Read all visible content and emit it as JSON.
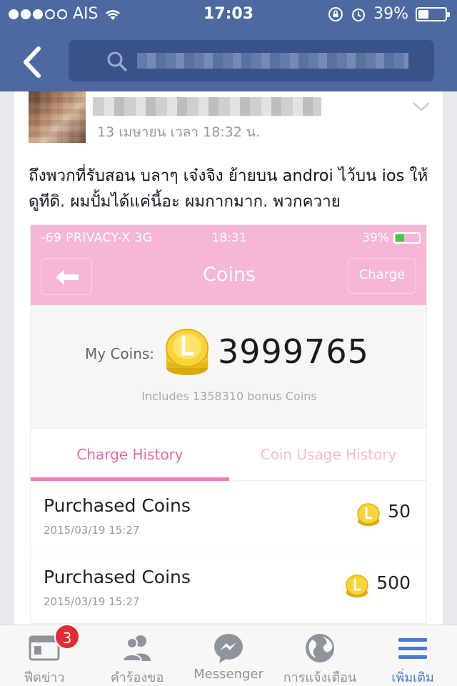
{
  "status_bar": {
    "carrier": "AIS",
    "time": "17:03",
    "battery": "39%",
    "battery_level": 0.39
  },
  "nav": {
    "search_placeholder": ""
  },
  "post": {
    "timestamp": "13 เมษายน เวลา 18:32 น.",
    "text": "ถึงพวกที่รับสอน บลาๆ  เจ๋งจิง ย้ายบน androi ไว้บน ios ให้ดูทีดิ. ผมปั้มได้แค่นี้อะ ผมกากมาก. พวกควาย"
  },
  "embedded": {
    "status": {
      "left": "-69 PRIVACY-X  3G",
      "time": "18:31",
      "battery": "39%"
    },
    "header": {
      "title": "Coins",
      "charge_label": "Charge"
    },
    "my_coins_label": "My Coins:",
    "my_coins_value": "3999765",
    "bonus_text": "Includes 1358310 bonus Coins",
    "tabs": [
      "Charge History",
      "Coin Usage History"
    ],
    "rows": [
      {
        "title": "Purchased Coins",
        "date": "2015/03/19 15:27",
        "amount": "50"
      },
      {
        "title": "Purchased Coins",
        "date": "2015/03/19 15:27",
        "amount": "500"
      }
    ],
    "colors": {
      "pink": "#f6b6d6",
      "accent": "#e36aa6"
    }
  },
  "tabbar": {
    "items": [
      {
        "label": "ฟีดข่าว",
        "icon": "news-feed-icon",
        "badge": "3"
      },
      {
        "label": "คำร้องขอ",
        "icon": "friend-requests-icon"
      },
      {
        "label": "Messenger",
        "icon": "messenger-icon"
      },
      {
        "label": "การแจ้งเตือน",
        "icon": "globe-icon"
      },
      {
        "label": "เพิ่มเติม",
        "icon": "menu-icon"
      }
    ],
    "active_color": "#4a77d4"
  },
  "colors": {
    "facebook_blue": "#4e69a2",
    "badge_red": "#e52b31"
  }
}
